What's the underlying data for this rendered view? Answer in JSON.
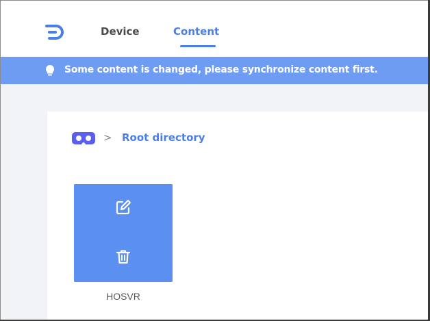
{
  "header": {
    "logo_icon": "brand-logo-icon",
    "tabs": [
      {
        "label": "Device",
        "active": false
      },
      {
        "label": "Content",
        "active": true
      }
    ]
  },
  "notice": {
    "icon": "lightbulb-icon",
    "text": "Some content is changed, please synchronize content first."
  },
  "breadcrumb": {
    "icon": "vr-headset-icon",
    "separator": ">",
    "root_label": "Root directory"
  },
  "folders": [
    {
      "name": "HOSVR",
      "actions": [
        "edit-icon",
        "trash-icon"
      ]
    }
  ],
  "colors": {
    "accent": "#4a7fe8",
    "notice_bg": "#6e9cf3",
    "card_bg": "#5b8ff0",
    "main_bg": "#f2f3f6"
  }
}
